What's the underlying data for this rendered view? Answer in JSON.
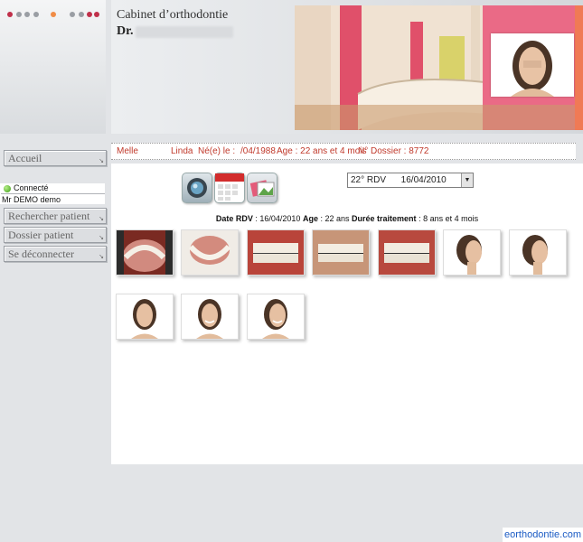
{
  "header": {
    "cabinet_title": "Cabinet d’orthodontie",
    "doctor_label": "Dr."
  },
  "colors": {
    "accent_red": "#c0392b",
    "dot_grey": "#9a9ea4",
    "dot_orange": "#f08c46",
    "dot_crimson": "#c0304a",
    "watermark_blue": "#1b5bc4"
  },
  "nav": {
    "accueil": "Accueil",
    "status": "Connecté",
    "user": "Mr DEMO demo",
    "rechercher": "Rechercher patient",
    "dossier": "Dossier patient",
    "deconnecter": "Se déconnecter"
  },
  "patient": {
    "title": "Melle",
    "firstname": "Linda",
    "born_label": "Né(e) le :",
    "born_value": "/04/1988",
    "age": "Age : 22 ans et 4 mois",
    "dossier": "N° Dossier : 8772"
  },
  "toolbar": {
    "camera_icon": "camera-icon",
    "calendar_icon": "calendar-icon",
    "photos_icon": "photos-icon"
  },
  "rdv_select": {
    "value": "22° RDV      16/04/2010"
  },
  "summary": {
    "date_label": "Date RDV",
    "date_value": ": 16/04/2010",
    "age_label": "Age",
    "age_value": ": 22 ans",
    "duree_label": "Durée traitement",
    "duree_value": ": 8 ans et 4 mois"
  },
  "watermark": "eorthodontie.com"
}
